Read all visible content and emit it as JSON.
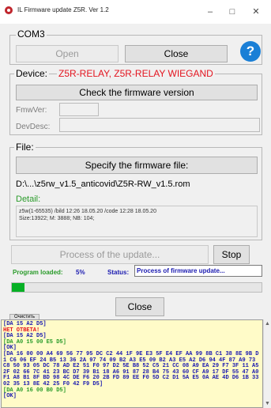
{
  "window": {
    "title": "IL Firmware update Z5R. Ver 1.2",
    "minimize": "–",
    "maximize": "□",
    "close": "✕"
  },
  "com": {
    "label": "COM3",
    "open_label": "Open",
    "close_label": "Close",
    "help_symbol": "?"
  },
  "device": {
    "label": "Device:",
    "name": "Z5R-RELAY, Z5R-RELAY WIEGAND",
    "check_label": "Check the firmware version",
    "fmw_label": "FmwVer:",
    "desc_label": "DevDesc:"
  },
  "file": {
    "label": "File:",
    "specify_label": "Specify the firmware file:",
    "path": "D:\\...\\z5rw_v1.5_anticovid\\Z5R-RW_v1.5.rom",
    "detail_label": "Detail:",
    "detail_line1": "z5w(1-65535) /bild 12:26 18.05.20 /code 12:28 18.05.20",
    "detail_line2": "Size:13922; M: 3888; NB: 104;"
  },
  "update": {
    "process_label": "Process of the update...",
    "stop_label": "Stop",
    "loaded_label": "Program loaded:",
    "loaded_value": "5%",
    "status_label": "Status:",
    "status_value": "Process of firmware update...",
    "progress": 0.05
  },
  "bottom": {
    "close_label": "Close",
    "clear_label": "Очистить"
  },
  "colors": {
    "accent_red": "#e3141f",
    "help_blue": "#1a7fd6",
    "green": "#2a9b2a",
    "log_bg": "#fffbc8"
  },
  "log": [
    {
      "text": "[DA 15 A2 D5]",
      "color": "#1a1ab0"
    },
    {
      "text": "НЕТ ОТВЕТА!",
      "color": "#e3141f"
    },
    {
      "text": "[DA 15 A2 D5]",
      "color": "#1a1ab0"
    },
    {
      "text": "[DA A0 15 00 E5 D5]",
      "color": "#2a9b2a"
    },
    {
      "text": "[OK]",
      "color": "#1a1ab0"
    },
    {
      "text": "[DA 16 00 00 A4 69 56 77 95 DC C2 44 1F 9E E3 5F E4 EF AA 99 8B C1 38 8E 9B D1 C6 06 EF 24 B5 13 36 2A 97 74 09 B2 A3 E5 09 B2 A3 E5 A2 D6 94 4F 87 A9 73 C8 50 93 05 DC 78 AD E2 51 F0 97 D2 5E B8 52 C5 21 CC 08 A9 EA 29 F7 3F 11 A5 2F 02 66 7C 41 23 BC D7 39 B1 18 A6 91 87 28 B4 75 43 60 CF A9 17 DF 55 47 A0 F1 A8 B1 8F BD 98 4C DE F6 20 2B FD 89 EE F0 5D C2 D1 5A E5 0A AE 4D D6 1B 33 02 35 13 8E 42 25 F0 42 F9 D5]",
      "color": "#1a1ab0"
    },
    {
      "text": "[DA A0 16 00 B0 D5]",
      "color": "#2a9b2a"
    },
    {
      "text": "[OK]",
      "color": "#1a1ab0"
    }
  ]
}
